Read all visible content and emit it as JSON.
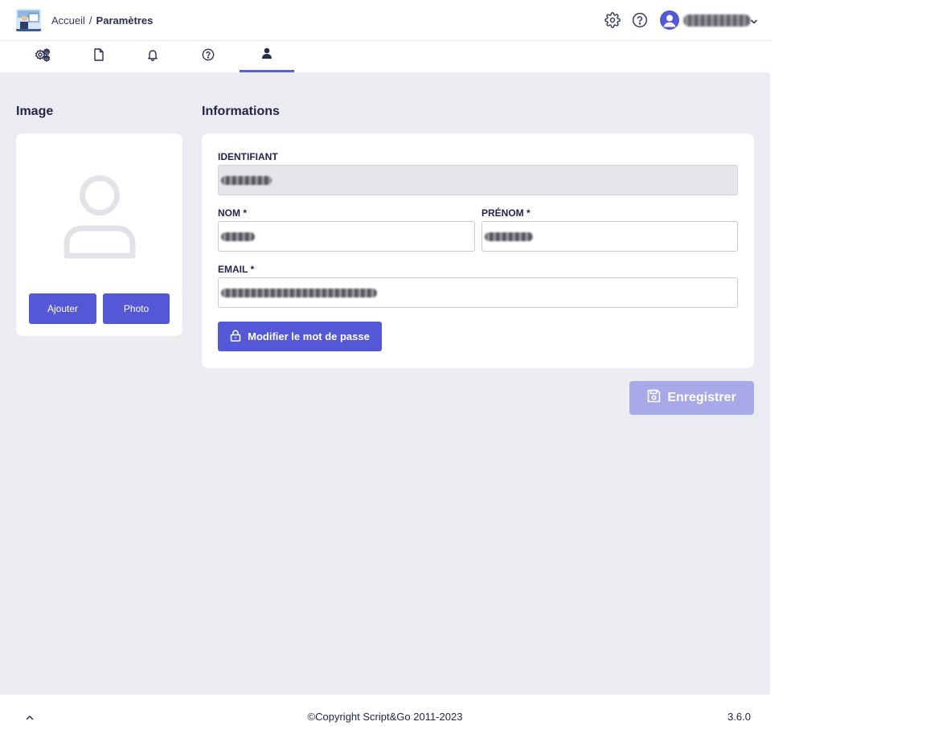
{
  "breadcrumb": {
    "home": "Accueil",
    "separator": "/",
    "current": "Paramètres"
  },
  "header": {
    "settings_icon": "gear-icon",
    "help_icon": "help-circle-icon",
    "user_icon": "user-avatar-icon"
  },
  "tabs": [
    {
      "icon": "gears-icon",
      "active": false
    },
    {
      "icon": "document-icon",
      "active": false
    },
    {
      "icon": "bell-icon",
      "active": false
    },
    {
      "icon": "help-circle-icon",
      "active": false
    },
    {
      "icon": "user-icon",
      "active": true
    }
  ],
  "image_section": {
    "title": "Image",
    "placeholder_icon": "user-outline-icon",
    "add_label": "Ajouter",
    "photo_label": "Photo"
  },
  "info_section": {
    "title": "Informations",
    "identifiant_label": "IDENTIFIANT",
    "nom_label": "NOM *",
    "prenom_label": "PRÉNOM *",
    "email_label": "EMAIL *",
    "password_button": "Modifier le mot de passe"
  },
  "save_label": "Enregistrer",
  "footer": {
    "copyright": "©Copyright Script&Go 2011-2023",
    "version": "3.6.0"
  },
  "colors": {
    "accent": "#5558d6",
    "accent_disabled": "#a7a9e8",
    "background": "#ebecf1",
    "text": "#23264a"
  }
}
